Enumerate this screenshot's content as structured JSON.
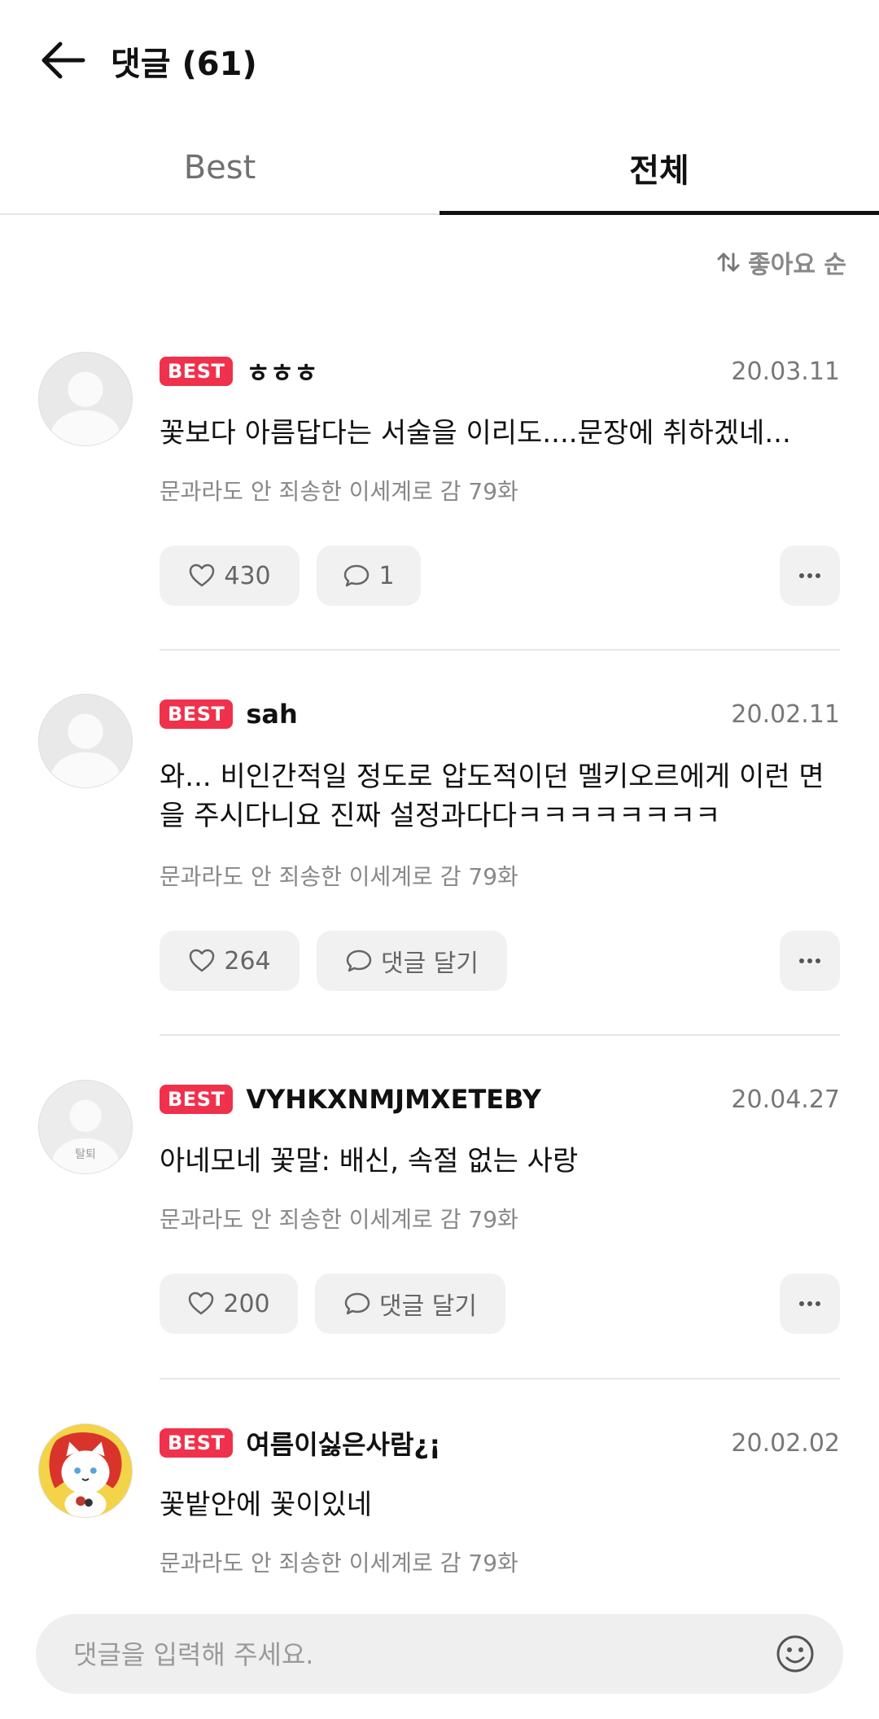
{
  "header": {
    "title": "댓글 (61)"
  },
  "tabs": [
    {
      "label": "Best",
      "active": false
    },
    {
      "label": "전체",
      "active": true
    }
  ],
  "sort": {
    "label": "좋아요 순"
  },
  "comments": [
    {
      "badge": "BEST",
      "user": "ㅎㅎㅎ",
      "date": "20.03.11",
      "text": "꽃보다 아름답다는 서술을 이리도....문장에 취하겠네...",
      "source": "문과라도 안 죄송한 이세계로 감 79화",
      "likes": "430",
      "reply": "1",
      "avatar": "default"
    },
    {
      "badge": "BEST",
      "user": "sah",
      "date": "20.02.11",
      "text": "와... 비인간적일 정도로 압도적이던 멜키오르에게 이런 면을 주시다니요 진짜 설정과다다ㅋㅋㅋㅋㅋㅋㅋㅋ",
      "source": "문과라도 안 죄송한 이세계로 감 79화",
      "likes": "264",
      "reply": "댓글 달기",
      "avatar": "default"
    },
    {
      "badge": "BEST",
      "user": "VYHKXNMJMXETEBY",
      "date": "20.04.27",
      "text": "아네모네 꽃말: 배신, 속절 없는 사랑",
      "source": "문과라도 안 죄송한 이세계로 감 79화",
      "likes": "200",
      "reply": "댓글 달기",
      "avatar": "withdrawn",
      "avatar_label": "탈퇴"
    },
    {
      "badge": "BEST",
      "user": "여름이싫은사람¿¡",
      "date": "20.02.02",
      "text": "꽃밭안에 꽃이있네",
      "source": "문과라도 안 죄송한 이세계로 감 79화",
      "avatar": "cat"
    }
  ],
  "input": {
    "placeholder": "댓글을 입력해 주세요."
  },
  "colors": {
    "badge": "#f0314c",
    "button_bg": "#f1f1f1",
    "input_bg": "#efefef"
  }
}
